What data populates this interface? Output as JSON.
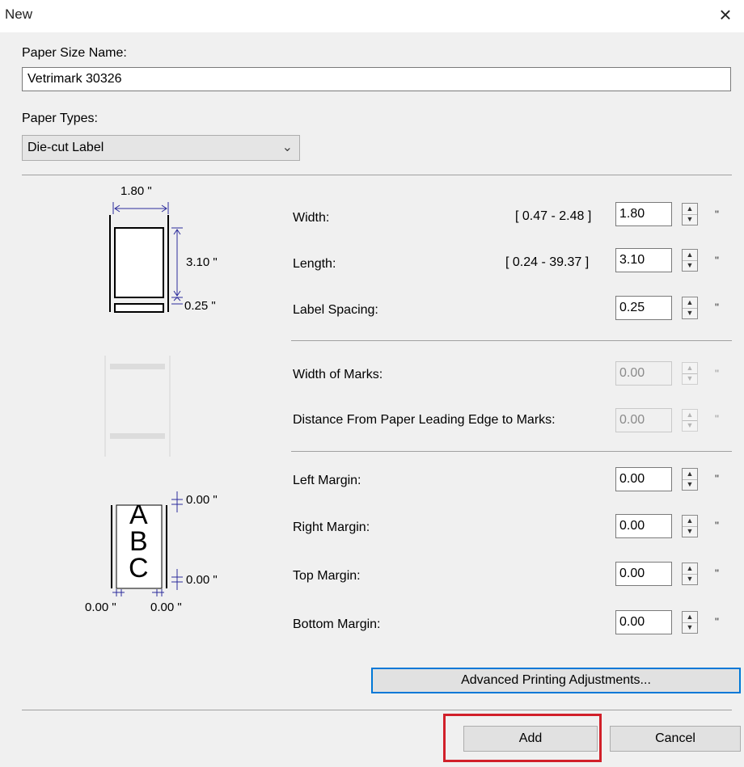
{
  "window": {
    "title": "New",
    "close_glyph": "×"
  },
  "paper_size_name": {
    "label": "Paper Size Name:",
    "value": "Vetrimark 30326"
  },
  "paper_types": {
    "label": "Paper Types:",
    "selected": "Die-cut Label"
  },
  "dimensions": {
    "width": {
      "label": "Width:",
      "range": "[ 0.47 - 2.48 ]",
      "value": "1.80",
      "unit": "\""
    },
    "length": {
      "label": "Length:",
      "range": "[ 0.24 - 39.37 ]",
      "value": "3.10",
      "unit": "\""
    },
    "label_spacing": {
      "label": "Label Spacing:",
      "value": "0.25",
      "unit": "\""
    }
  },
  "marks": {
    "width_of_marks": {
      "label": "Width of Marks:",
      "value": "0.00",
      "unit": "\""
    },
    "distance": {
      "label": "Distance From Paper Leading Edge to Marks:",
      "value": "0.00",
      "unit": "\""
    }
  },
  "margins": {
    "left": {
      "label": "Left Margin:",
      "value": "0.00",
      "unit": "\""
    },
    "right": {
      "label": "Right Margin:",
      "value": "0.00",
      "unit": "\""
    },
    "top": {
      "label": "Top Margin:",
      "value": "0.00",
      "unit": "\""
    },
    "bottom": {
      "label": "Bottom Margin:",
      "value": "0.00",
      "unit": "\""
    }
  },
  "diagram": {
    "width": "1.80 \"",
    "length": "3.10 \"",
    "spacing": "0.25 \"",
    "margin_top": "0.00 \"",
    "margin_bottom": "0.00 \"",
    "margin_left": "0.00 \"",
    "margin_right": "0.00 \"",
    "sample_letters": [
      "A",
      "B",
      "C"
    ]
  },
  "buttons": {
    "advanced": "Advanced Printing Adjustments...",
    "add": "Add",
    "cancel": "Cancel"
  },
  "colors": {
    "highlight": "#d1202a",
    "focus": "#0078d7",
    "dimension_lines": "#2b2b9b"
  }
}
